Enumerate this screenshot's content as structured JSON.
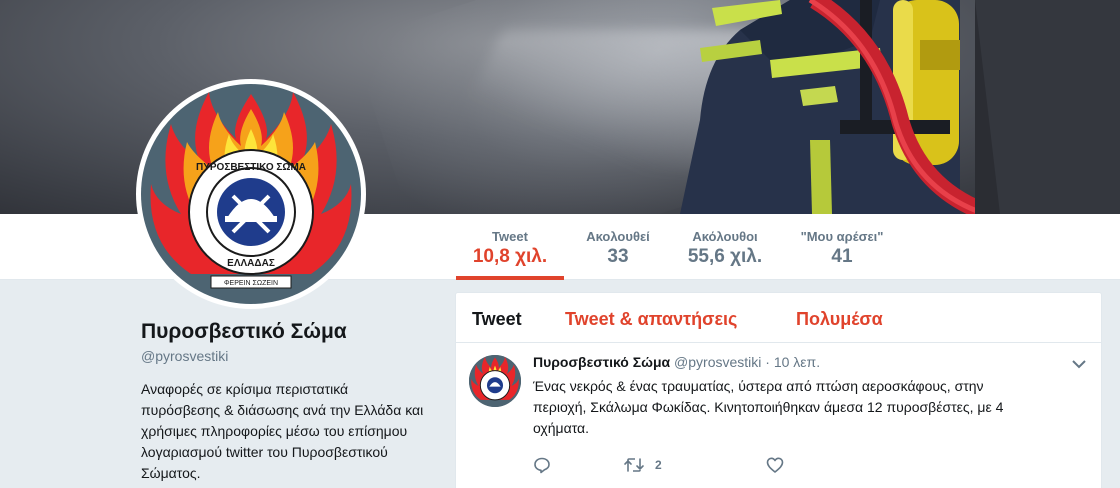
{
  "profile": {
    "name": "Πυροσβεστικό Σώμα",
    "handle": "@pyrosvestiki",
    "bio": "Αναφορές σε κρίσιμα περιστατικά πυρόσβεσης & διάσωσης ανά την Ελλάδα και χρήσιμες πληροφορίες μέσω του επίσημου λογαριασμού twitter του Πυροσβεστικού Σώματος.",
    "logo_text_top": "ΠΥΡΟΣΒΕΣΤΙΚΟ ΣΩΜΑ",
    "logo_text_bottom": "ΕΛΛΑΔΑΣ",
    "logo_motto": "ΦΕΡΕΙΝ ΣΩΖΕΙΝ"
  },
  "stats": [
    {
      "label": "Tweet",
      "value": "10,8 χιλ.",
      "active": true
    },
    {
      "label": "Ακολουθεί",
      "value": "33",
      "active": false
    },
    {
      "label": "Ακόλουθοι",
      "value": "55,6 χιλ.",
      "active": false
    },
    {
      "label": "\"Μου αρέσει\"",
      "value": "41",
      "active": false
    }
  ],
  "tabs": [
    {
      "label": "Tweet",
      "active": true
    },
    {
      "label": "Tweet & απαντήσεις",
      "active": false
    },
    {
      "label": "Πολυμέσα",
      "active": false
    }
  ],
  "tweet": {
    "name": "Πυροσβεστικό Σώμα",
    "handle": "@pyrosvestiki",
    "separator": "·",
    "time": "10 λεπ.",
    "text": "Ένας νεκρός & ένας τραυματίας, ύστερα από πτώση αεροσκάφους, στην περιοχή, Σκάλωμα Φωκίδας. Κινητοποιήθηκαν άμεσα 12 πυροσβέστες, με 4 οχήματα.",
    "reply_icon": "reply-icon",
    "retweet_icon": "retweet-icon",
    "retweet_count": "2",
    "like_icon": "heart-icon"
  },
  "colors": {
    "accent": "#e0432c",
    "text": "#14171a",
    "muted": "#657786",
    "background": "#e6ecf0"
  }
}
